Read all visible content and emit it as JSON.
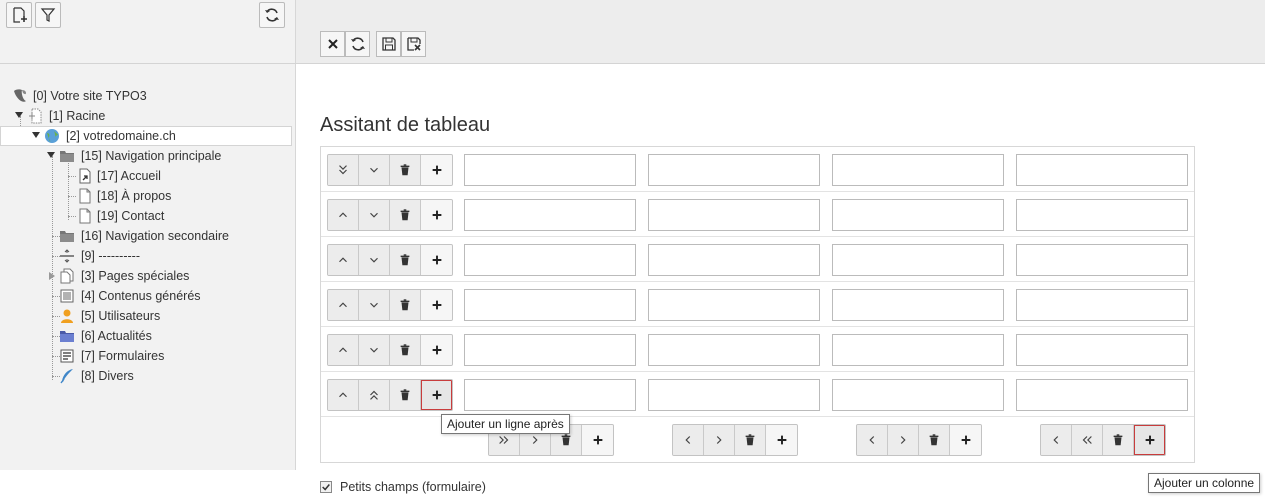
{
  "tree_toolbar": {
    "new_page_icon": "new-page-icon",
    "filter_icon": "filter-icon",
    "refresh_icon": "refresh-icon"
  },
  "tree": [
    {
      "id": "site",
      "label": "[0] Votre site TYPO3",
      "icon": "typo3-logo-icon"
    },
    {
      "id": "racine",
      "label": "[1] Racine",
      "icon": "root-page-icon"
    },
    {
      "id": "domain",
      "label": "[2] votredomaine.ch",
      "icon": "globe-icon"
    },
    {
      "id": "nav-principale",
      "label": "[15] Navigation principale",
      "icon": "folder-icon"
    },
    {
      "id": "accueil",
      "label": "[17] Accueil",
      "icon": "shortcut-page-icon"
    },
    {
      "id": "apropos",
      "label": "[18] À propos",
      "icon": "page-icon"
    },
    {
      "id": "contact",
      "label": "[19] Contact",
      "icon": "page-icon"
    },
    {
      "id": "nav-secondaire",
      "label": "[16] Navigation secondaire",
      "icon": "folder-icon"
    },
    {
      "id": "separator",
      "label": "[9] ----------",
      "icon": "spacer-icon"
    },
    {
      "id": "pages-speciales",
      "label": "[3] Pages spéciales",
      "icon": "pages-icon"
    },
    {
      "id": "contenus",
      "label": "[4] Contenus générés",
      "icon": "content-icon"
    },
    {
      "id": "utilisateurs",
      "label": "[5] Utilisateurs",
      "icon": "users-icon"
    },
    {
      "id": "actualites",
      "label": "[6] Actualités",
      "icon": "news-folder-icon"
    },
    {
      "id": "formulaires",
      "label": "[7] Formulaires",
      "icon": "forms-icon"
    },
    {
      "id": "divers",
      "label": "[8] Divers",
      "icon": "feather-icon"
    }
  ],
  "doc_header": {
    "close_icon": "close-icon",
    "reload_icon": "reload-icon",
    "save_icon": "save-icon",
    "save_close_icon": "save-close-icon"
  },
  "title": "Assitant de tableau",
  "tooltips": {
    "add_row_after": "Ajouter un ligne après",
    "add_column": "Ajouter un colonne"
  },
  "small_fields_label": "Petits champs (formulaire)",
  "colors": {
    "active_outline": "#c83c3c",
    "tree_bg": "#f2f2f2",
    "header_bg": "#ededed"
  }
}
